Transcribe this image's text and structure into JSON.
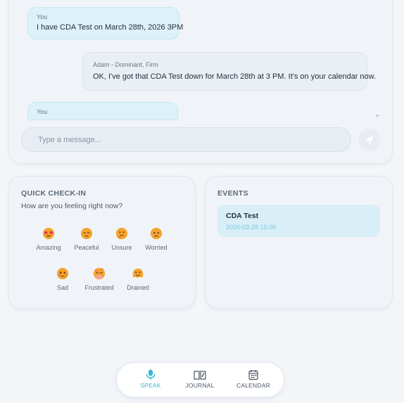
{
  "chat": {
    "messages": [
      {
        "sender": "You",
        "text": "I have CDA Test on March 28th, 2026 3PM"
      },
      {
        "sender": "Adam - Dominant, Firm",
        "text": "OK, I've got that CDA Test down for March 28th at 3 PM. It's on your calendar now."
      },
      {
        "sender": "You",
        "text": ""
      }
    ],
    "input_placeholder": "Type a message...",
    "send_icon": "send-icon"
  },
  "checkin": {
    "title": "QUICK CHECK-IN",
    "subtitle": "How are you feeling right now?",
    "moods": [
      {
        "label": "Amazing",
        "icon": "star-eyes-face-icon"
      },
      {
        "label": "Peaceful",
        "icon": "relieved-face-icon"
      },
      {
        "label": "Unsure",
        "icon": "thinking-face-icon"
      },
      {
        "label": "Worried",
        "icon": "worried-face-icon"
      },
      {
        "label": "Sad",
        "icon": "sad-face-icon"
      },
      {
        "label": "Frustrated",
        "icon": "frustrated-face-icon"
      },
      {
        "label": "Drained",
        "icon": "melting-face-icon"
      }
    ]
  },
  "events": {
    "title": "EVENTS",
    "items": [
      {
        "title": "CDA Test",
        "time": "2026-03-28 15:00"
      }
    ]
  },
  "nav": {
    "items": [
      {
        "label": "SPEAK",
        "icon": "microphone-icon",
        "active": true
      },
      {
        "label": "JOURNAL",
        "icon": "journal-icon",
        "active": false
      },
      {
        "label": "CALENDAR",
        "icon": "calendar-icon",
        "active": false
      }
    ]
  },
  "colors": {
    "accent": "#39b6d6",
    "user_bubble": "#dcf1f8",
    "event_card": "#d8eff7"
  }
}
